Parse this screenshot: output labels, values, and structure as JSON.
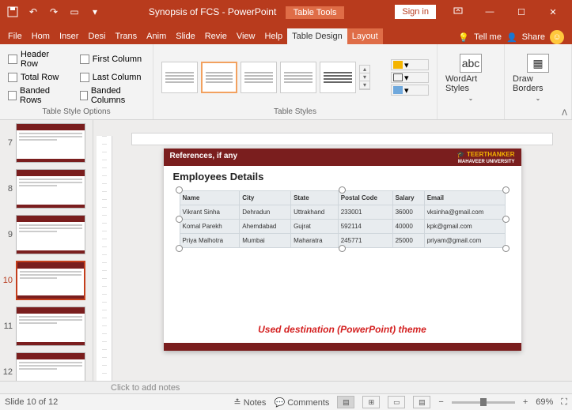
{
  "titlebar": {
    "doc_title": "Synopsis of FCS  -  PowerPoint",
    "context_tab": "Table Tools",
    "signin": "Sign in"
  },
  "tabs": {
    "file": "File",
    "home": "Hom",
    "insert": "Inser",
    "design": "Desi",
    "trans": "Trans",
    "anim": "Anim",
    "slide": "Slide",
    "review": "Revie",
    "view": "View",
    "help": "Help",
    "table_design": "Table Design",
    "layout": "Layout",
    "tellme": "Tell me",
    "share": "Share"
  },
  "ribbon": {
    "opts_group": "Table Style Options",
    "opt_header_row": "Header Row",
    "opt_first_col": "First Column",
    "opt_total_row": "Total Row",
    "opt_last_col": "Last Column",
    "opt_banded_rows": "Banded Rows",
    "opt_banded_cols": "Banded Columns",
    "styles_group": "Table Styles",
    "wordart": "WordArt Styles",
    "draw_borders": "Draw Borders"
  },
  "thumbs": [
    {
      "num": "7"
    },
    {
      "num": "8"
    },
    {
      "num": "9"
    },
    {
      "num": "10",
      "active": true
    },
    {
      "num": "11"
    },
    {
      "num": "12"
    }
  ],
  "slide": {
    "ref_label": "References, if any",
    "logo_top": "TEERTHANKER",
    "logo_sub": "MAHAVEER UNIVERSITY",
    "title": "Employees Details",
    "caption": "Used destination (PowerPoint) theme",
    "headers": [
      "Name",
      "City",
      "State",
      "Postal Code",
      "Salary",
      "Email"
    ],
    "rows": [
      [
        "Vikrant Sinha",
        "Dehradun",
        "Uttrakhand",
        "233001",
        "36000",
        "vksinha@gmail.com"
      ],
      [
        "Komal Parekh",
        "Ahemdabad",
        "Gujrat",
        "592114",
        "40000",
        "kpk@gmail.com"
      ],
      [
        "Priya Malhotra",
        "Mumbai",
        "Maharatra",
        "245771",
        "25000",
        "priyam@gmail.com"
      ]
    ]
  },
  "notes_placeholder": "Click to add notes",
  "status": {
    "slide_of": "Slide 10 of 12",
    "notes": "Notes",
    "comments": "Comments",
    "zoom_pct": "69%"
  }
}
